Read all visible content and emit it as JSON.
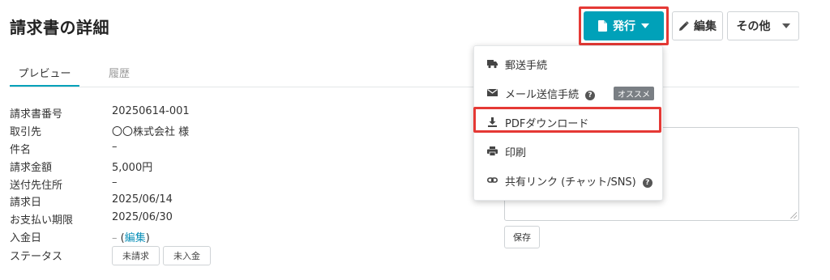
{
  "header": {
    "title": "請求書の詳細",
    "issue_label": "発行",
    "edit_label": "編集",
    "other_label": "その他"
  },
  "tabs": [
    {
      "label": "プレビュー",
      "active": true
    },
    {
      "label": "履歴",
      "active": false
    }
  ],
  "details": {
    "invoice_number": {
      "label": "請求書番号",
      "value": "20250614-001"
    },
    "client": {
      "label": "取引先",
      "value": "〇〇株式会社 様"
    },
    "subject": {
      "label": "件名",
      "value": "–"
    },
    "amount": {
      "label": "請求金額",
      "value": "5,000円"
    },
    "destination": {
      "label": "送付先住所",
      "value": "–"
    },
    "invoice_date": {
      "label": "請求日",
      "value": "2025/06/14"
    },
    "due_date": {
      "label": "お支払い期限",
      "value": "2025/06/30"
    },
    "payment_date": {
      "label": "入金日",
      "value": "–",
      "edit_prefix": " (",
      "edit_link": "編集",
      "edit_suffix": ")"
    },
    "status": {
      "label": "ステータス",
      "tags": [
        "未請求",
        "未入金"
      ]
    }
  },
  "memo": {
    "placeholder_fragment": "。)",
    "save_label": "保存"
  },
  "issue_menu": {
    "items": [
      {
        "label": "郵送手続",
        "icon": "truck-icon"
      },
      {
        "label": "メール送信手続",
        "icon": "envelope-icon",
        "badge": "オススメ"
      },
      {
        "label": "PDFダウンロード",
        "icon": "download-icon"
      },
      {
        "label": "印刷",
        "icon": "printer-icon"
      },
      {
        "label": "共有リンク (チャット/SNS)",
        "icon": "link-icon"
      }
    ]
  },
  "colors": {
    "accent": "#00a1b9",
    "highlight": "#e53935",
    "link": "#0a8fb8"
  }
}
